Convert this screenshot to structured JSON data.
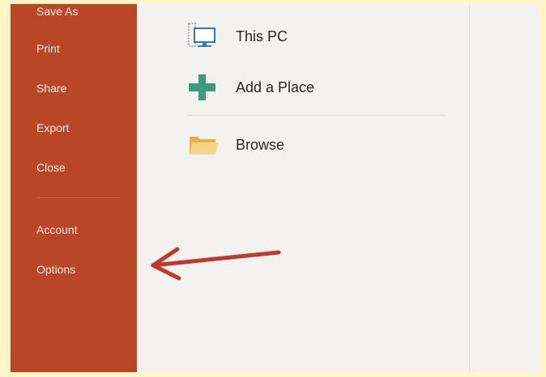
{
  "sidebar": {
    "items": [
      {
        "label": "Save As"
      },
      {
        "label": "Print"
      },
      {
        "label": "Share"
      },
      {
        "label": "Export"
      },
      {
        "label": "Close"
      },
      {
        "label": "Account"
      },
      {
        "label": "Options"
      }
    ]
  },
  "places": [
    {
      "label": "This PC",
      "icon": "computer-icon"
    },
    {
      "label": "Add a Place",
      "icon": "plus-icon"
    },
    {
      "label": "Browse",
      "icon": "folder-icon"
    }
  ],
  "colors": {
    "backstage_accent": "#b94727",
    "annotation_arrow": "#c0392b",
    "background_border": "#fff5c6"
  }
}
